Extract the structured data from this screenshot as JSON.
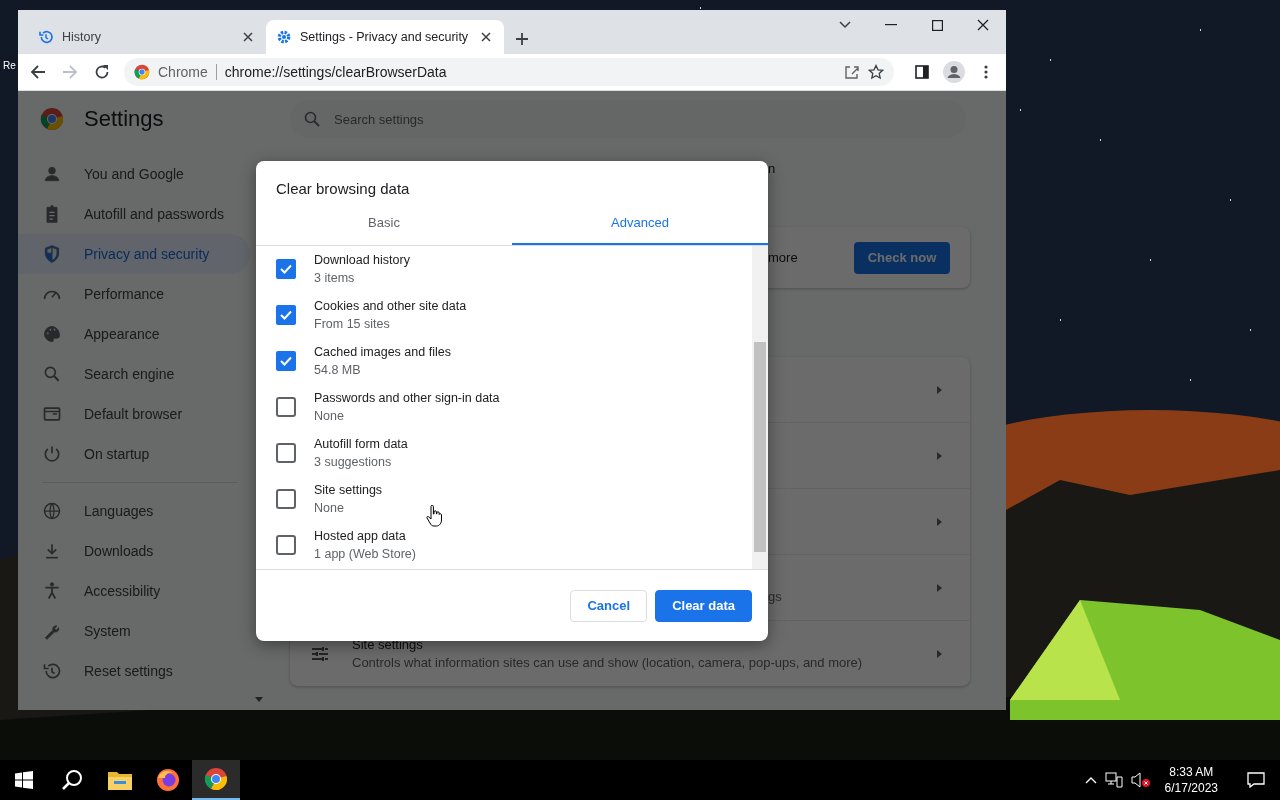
{
  "desktop": {
    "icon_label": "Re"
  },
  "browser": {
    "tabs": [
      {
        "title": "History",
        "selected": false
      },
      {
        "title": "Settings - Privacy and security",
        "selected": true
      }
    ],
    "omnibox": {
      "chip": "Chrome",
      "url": "chrome://settings/clearBrowserData"
    }
  },
  "settings": {
    "title": "Settings",
    "search": {
      "placeholder": "Search settings"
    },
    "sidebar": {
      "groups": [
        {
          "items": [
            {
              "label": "You and Google",
              "selected": false
            },
            {
              "label": "Autofill and passwords",
              "selected": false
            },
            {
              "label": "Privacy and security",
              "selected": true
            },
            {
              "label": "Performance",
              "selected": false
            },
            {
              "label": "Appearance",
              "selected": false
            },
            {
              "label": "Search engine",
              "selected": false
            },
            {
              "label": "Default browser",
              "selected": false
            },
            {
              "label": "On startup",
              "selected": false
            }
          ]
        },
        {
          "items": [
            {
              "label": "Languages",
              "selected": false
            },
            {
              "label": "Downloads",
              "selected": false
            },
            {
              "label": "Accessibility",
              "selected": false
            },
            {
              "label": "System",
              "selected": false
            },
            {
              "label": "Reset settings",
              "selected": false
            }
          ]
        }
      ]
    },
    "main": {
      "fragment_top": "n",
      "safety_card": {
        "text": "more",
        "button": "Check now"
      },
      "privacy_rows": [
        {
          "kind": "covered"
        },
        {
          "kind": "covered"
        },
        {
          "kind": "covered"
        },
        {
          "kind": "covered",
          "description": "gs"
        },
        {
          "kind": "full",
          "title": "Site settings",
          "description": "Controls what information sites can use and show (location, camera, pop-ups, and more)"
        }
      ]
    }
  },
  "dialog": {
    "title": "Clear browsing data",
    "tabs": [
      {
        "label": "Basic",
        "selected": false
      },
      {
        "label": "Advanced",
        "selected": true
      }
    ],
    "items": [
      {
        "title": "Download history",
        "detail": "3 items",
        "checked": true
      },
      {
        "title": "Cookies and other site data",
        "detail": "From 15 sites",
        "checked": true
      },
      {
        "title": "Cached images and files",
        "detail": "54.8 MB",
        "checked": true
      },
      {
        "title": "Passwords and other sign-in data",
        "detail": "None",
        "checked": false
      },
      {
        "title": "Autofill form data",
        "detail": "3 suggestions",
        "checked": false
      },
      {
        "title": "Site settings",
        "detail": "None",
        "checked": false
      },
      {
        "title": "Hosted app data",
        "detail": "1 app (Web Store)",
        "checked": false
      }
    ],
    "buttons": [
      {
        "label": "Cancel",
        "kind": "secondary"
      },
      {
        "label": "Clear data",
        "kind": "primary"
      }
    ]
  },
  "taskbar": {
    "apps": [
      {
        "kind": "start",
        "selected": false
      },
      {
        "kind": "search",
        "selected": false
      },
      {
        "kind": "files",
        "selected": false
      },
      {
        "kind": "firefox",
        "selected": false
      },
      {
        "kind": "chrome",
        "selected": true
      }
    ],
    "clock": {
      "time": "8:33 AM",
      "date": "6/17/2023"
    }
  }
}
